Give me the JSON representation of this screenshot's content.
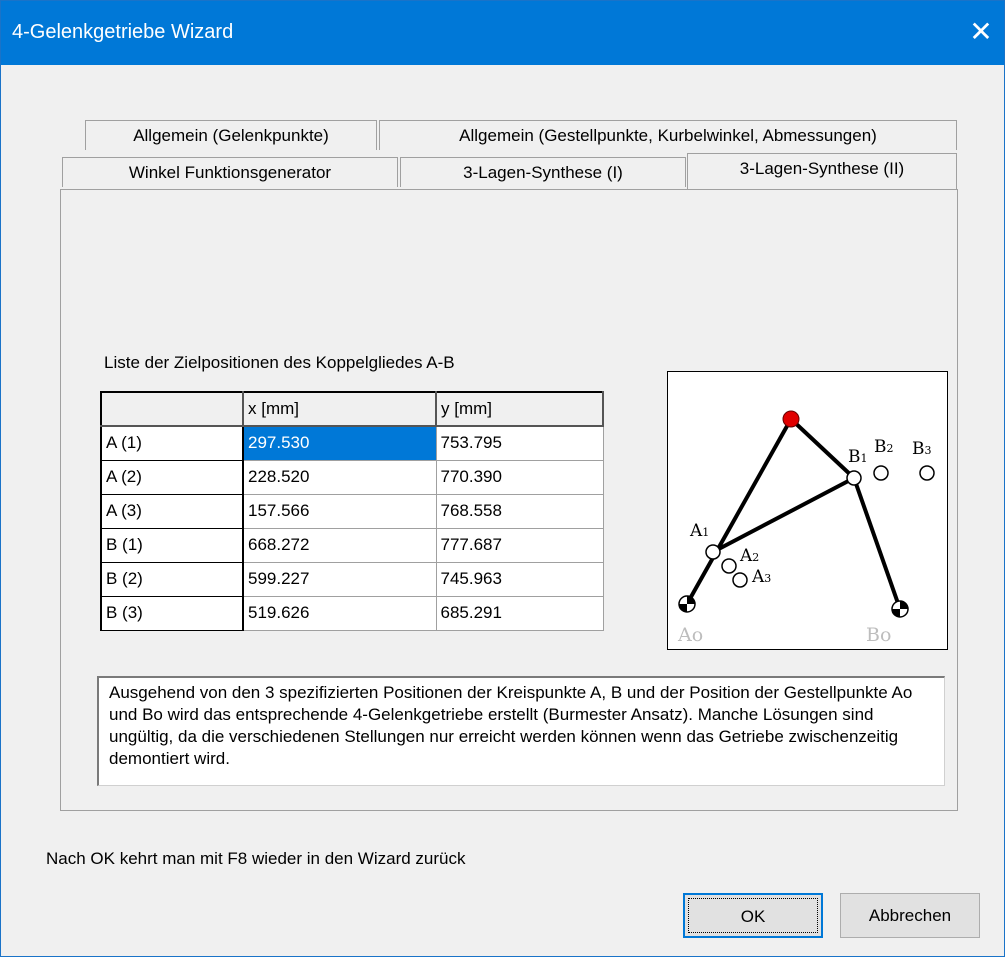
{
  "window": {
    "title": "4-Gelenkgetriebe Wizard",
    "close_glyph": "✕"
  },
  "tabs": {
    "row1": [
      "Allgemein (Gelenkpunkte)",
      "Allgemein (Gestellpunkte, Kurbelwinkel, Abmessungen)"
    ],
    "row2": [
      "Winkel Funktionsgenerator",
      "3-Lagen-Synthese (I)",
      "3-Lagen-Synthese (II)"
    ],
    "active": "3-Lagen-Synthese (II)"
  },
  "panel": {
    "list_label": "Liste der Zielpositionen des Koppelgliedes A-B",
    "table": {
      "headers": [
        "",
        "x [mm]",
        "y [mm]"
      ],
      "rows": [
        [
          "A (1)",
          "297.530",
          "753.795"
        ],
        [
          "A (2)",
          "228.520",
          "770.390"
        ],
        [
          "A (3)",
          "157.566",
          "768.558"
        ],
        [
          "B (1)",
          "668.272",
          "777.687"
        ],
        [
          "B (2)",
          "599.227",
          "745.963"
        ],
        [
          "B (3)",
          "519.626",
          "685.291"
        ]
      ],
      "selected_cell": "A (1) x"
    },
    "diagram_labels": {
      "a1": "A",
      "a1_sub": "1",
      "a2": "A",
      "a2_sub": "2",
      "a3": "A",
      "a3_sub": "3",
      "b1": "B",
      "b1_sub": "1",
      "b2": "B",
      "b2_sub": "2",
      "b3": "B",
      "b3_sub": "3",
      "ao": "Ao",
      "bo": "Bo"
    },
    "description": "Ausgehend von den 3 spezifizierten Positionen der Kreispunkte A, B und der Position der Gestellpunkte Ao und Bo wird das entsprechende 4-Gelenkgetriebe erstellt (Burmester Ansatz). Manche Lösungen sind ungültig, da die verschiedenen Stellungen nur erreicht werden können wenn das Getriebe zwischenzeitig demontiert wird."
  },
  "footer": {
    "hint": "Nach OK kehrt man mit F8 wieder in den Wizard zurück",
    "ok_label": "OK",
    "cancel_label": "Abbrechen"
  },
  "colors": {
    "titlebar": "#0078d7",
    "selection": "#0078d7",
    "coupler_point": "#e00000"
  }
}
